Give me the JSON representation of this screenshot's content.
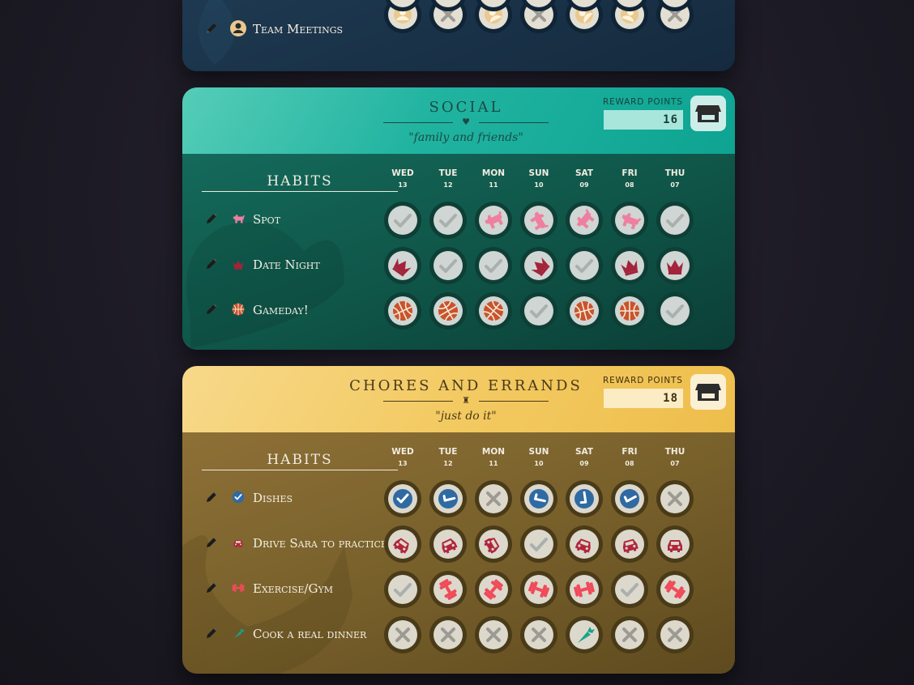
{
  "colors": {
    "social_accent": "#1fb3a0",
    "chores_accent": "#f3ca62",
    "check_gray": "#a9b0ad",
    "x_gray": "#9d9a94",
    "pink": "#ef7fa0",
    "crimson": "#a3243b",
    "orange_ball": "#c9542c",
    "blue_check": "#2f6aa3",
    "car_red": "#b0263c",
    "gym_red": "#f04a5a",
    "carrot_teal": "#17a38e"
  },
  "days": [
    {
      "name": "WED",
      "date": "13"
    },
    {
      "name": "TUE",
      "date": "12"
    },
    {
      "name": "MON",
      "date": "11"
    },
    {
      "name": "SUN",
      "date": "10"
    },
    {
      "name": "SAT",
      "date": "09"
    },
    {
      "name": "FRI",
      "date": "08"
    },
    {
      "name": "THU",
      "date": "07"
    }
  ],
  "top_card": {
    "habits": [
      {
        "name": "Team Meetings",
        "icon": "person-circle-icon",
        "cells": [
          "icon",
          "x",
          "icon",
          "x",
          "icon",
          "icon",
          "x"
        ]
      }
    ]
  },
  "social": {
    "title": "SOCIAL",
    "divider_icon": "♥",
    "subtitle": "\"family and friends\"",
    "reward_label": "REWARD POINTS",
    "reward_points": "16",
    "habits_heading": "HABITS",
    "habits": [
      {
        "name": "Spot",
        "icon": "dog-icon",
        "cells": [
          "check",
          "check",
          "icon",
          "icon",
          "icon",
          "icon",
          "check"
        ]
      },
      {
        "name": "Date Night",
        "icon": "crown-icon",
        "cells": [
          "icon",
          "check",
          "check",
          "icon",
          "check",
          "icon",
          "icon"
        ]
      },
      {
        "name": "Gameday!",
        "icon": "basketball-icon",
        "cells": [
          "icon",
          "icon",
          "icon",
          "check",
          "icon",
          "icon",
          "check"
        ]
      }
    ]
  },
  "chores": {
    "title": "CHORES AND ERRANDS",
    "divider_icon": "♜",
    "subtitle": "\"just do it\"",
    "reward_label": "REWARD POINTS",
    "reward_points": "18",
    "habits_heading": "HABITS",
    "habits": [
      {
        "name": "Dishes",
        "icon": "check-circle-icon",
        "cells": [
          "icon",
          "icon",
          "x",
          "icon",
          "icon",
          "icon",
          "x"
        ]
      },
      {
        "name": "Drive Sara to practice",
        "icon": "car-icon",
        "cells": [
          "icon",
          "icon",
          "icon",
          "check",
          "icon",
          "icon",
          "icon"
        ]
      },
      {
        "name": "Exercise/Gym",
        "icon": "dumbbell-icon",
        "cells": [
          "check",
          "icon",
          "icon",
          "icon",
          "icon",
          "check",
          "icon"
        ]
      },
      {
        "name": "Cook a real dinner",
        "icon": "carrot-icon",
        "cells": [
          "x",
          "x",
          "x",
          "x",
          "icon",
          "x",
          "x"
        ]
      }
    ]
  }
}
